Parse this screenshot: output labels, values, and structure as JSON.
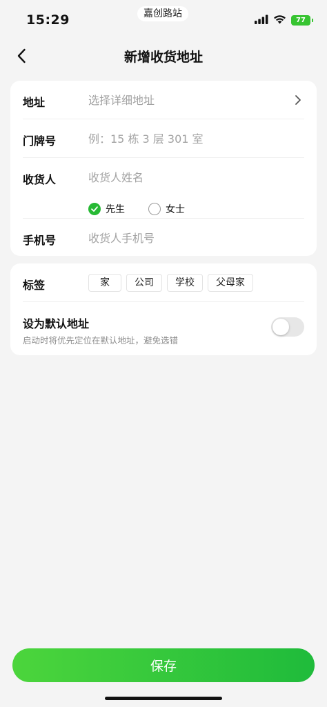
{
  "status_bar": {
    "time": "15:29",
    "location_pill": "嘉创路站",
    "battery": "77"
  },
  "nav": {
    "title": "新增收货地址",
    "back_icon": "chevron-left-icon"
  },
  "address_form": {
    "address": {
      "label": "地址",
      "placeholder": "选择详细地址",
      "value": ""
    },
    "house_number": {
      "label": "门牌号",
      "placeholder": "例：15 栋 3 层 301 室",
      "value": ""
    },
    "consignee": {
      "label": "收货人",
      "placeholder": "收货人姓名",
      "value": "",
      "genders": [
        {
          "label": "先生",
          "selected": true
        },
        {
          "label": "女士",
          "selected": false
        }
      ]
    },
    "phone": {
      "label": "手机号",
      "placeholder": "收货人手机号",
      "value": ""
    }
  },
  "tags_section": {
    "label": "标签",
    "tags": [
      "家",
      "公司",
      "学校",
      "父母家"
    ]
  },
  "default_setting": {
    "title": "设为默认地址",
    "subtitle": "启动时将优先定位在默认地址，避免选错",
    "enabled": false
  },
  "save_button": {
    "label": "保存"
  },
  "colors": {
    "accent": "#27b934",
    "background": "#f4f4f4",
    "card": "#ffffff",
    "placeholder": "#a3a3a3"
  }
}
